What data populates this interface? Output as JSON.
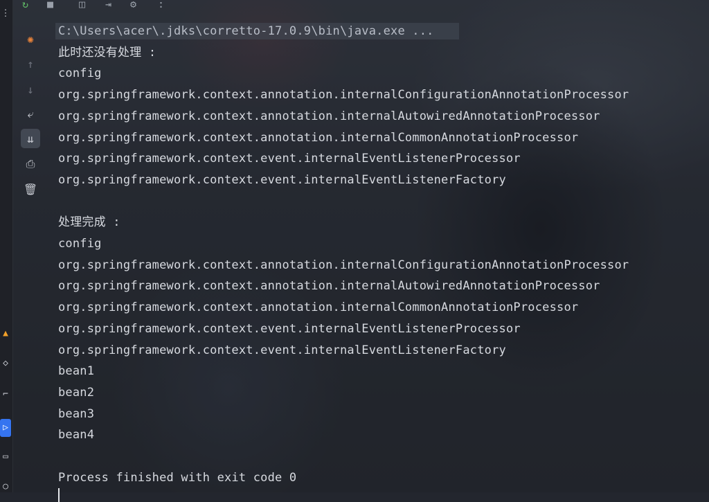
{
  "toolbar": {
    "icons": [
      "rerun-icon",
      "stop-icon",
      "camera-icon",
      "export-icon",
      "settings-icon",
      "more-icon"
    ],
    "more_label": ":"
  },
  "side_tools": [
    "debug-icon",
    "arrow-up-icon",
    "arrow-down-icon",
    "soft-wrap-icon",
    "scroll-to-end-icon",
    "print-icon",
    "trash-icon"
  ],
  "left_strip_icons": [
    "more-vertical-icon",
    "plugin-icon",
    "git-icon",
    "build-icon",
    "run-icon",
    "terminal-icon",
    "problems-icon"
  ],
  "console": {
    "command": "C:\\Users\\acer\\.jdks\\corretto-17.0.9\\bin\\java.exe ...",
    "lines": [
      "此时还没有处理 :",
      "config",
      "org.springframework.context.annotation.internalConfigurationAnnotationProcessor",
      "org.springframework.context.annotation.internalAutowiredAnnotationProcessor",
      "org.springframework.context.annotation.internalCommonAnnotationProcessor",
      "org.springframework.context.event.internalEventListenerProcessor",
      "org.springframework.context.event.internalEventListenerFactory",
      "",
      "处理完成 :",
      "config",
      "org.springframework.context.annotation.internalConfigurationAnnotationProcessor",
      "org.springframework.context.annotation.internalAutowiredAnnotationProcessor",
      "org.springframework.context.annotation.internalCommonAnnotationProcessor",
      "org.springframework.context.event.internalEventListenerProcessor",
      "org.springframework.context.event.internalEventListenerFactory",
      "bean1",
      "bean2",
      "bean3",
      "bean4",
      "",
      "Process finished with exit code 0"
    ]
  }
}
